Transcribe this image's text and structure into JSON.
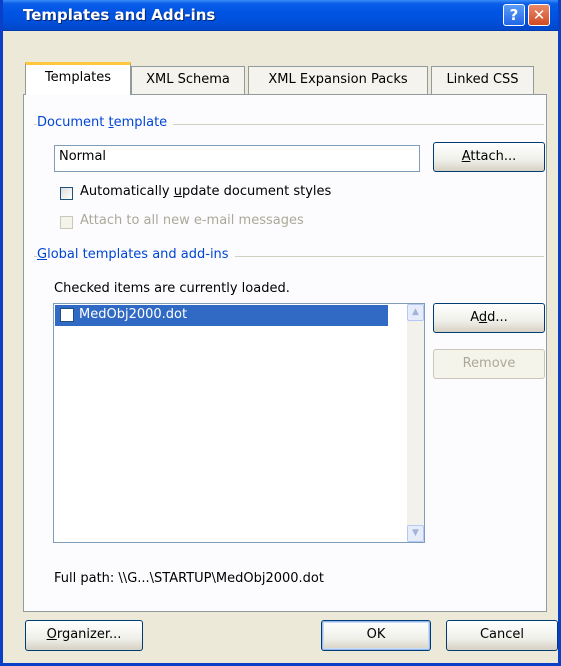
{
  "window": {
    "title": "Templates and Add-ins",
    "help_glyph": "?",
    "close_glyph": "✕",
    "title_color": "#0054e3"
  },
  "tabs": [
    {
      "label": "Templates",
      "active": true
    },
    {
      "label": "XML Schema",
      "active": false
    },
    {
      "label": "XML Expansion Packs",
      "active": false
    },
    {
      "label": "Linked CSS",
      "active": false
    }
  ],
  "document_template": {
    "group_label_pre": "Document ",
    "group_label_u": "t",
    "group_label_post": "emplate",
    "value": "Normal",
    "attach_pre": "",
    "attach_u": "A",
    "attach_post": "ttach...",
    "auto_update_pre": "Automatically ",
    "auto_update_u": "u",
    "auto_update_post": "pdate document styles",
    "auto_update_checked": false,
    "attach_email_label": "Attach to all new e-mail messages",
    "attach_email_enabled": false
  },
  "global_templates": {
    "group_label_u": "G",
    "group_label_post": "lobal templates and add-ins",
    "hint": "Checked items are currently loaded.",
    "items": [
      {
        "label": "MedObj2000.dot",
        "checked": false,
        "selected": true
      }
    ],
    "add_pre": "A",
    "add_u": "d",
    "add_post": "d...",
    "remove_label": "Remove",
    "remove_enabled": false,
    "full_path": "Full path:  \\\\G...\\STARTUP\\MedObj2000.dot"
  },
  "footer": {
    "organizer_u": "O",
    "organizer_post": "rganizer...",
    "ok_label": "OK",
    "cancel_label": "Cancel"
  },
  "colors": {
    "accent_blue": "#0046d5",
    "selection": "#316ac5",
    "tab_highlight": "#ffc83c"
  }
}
